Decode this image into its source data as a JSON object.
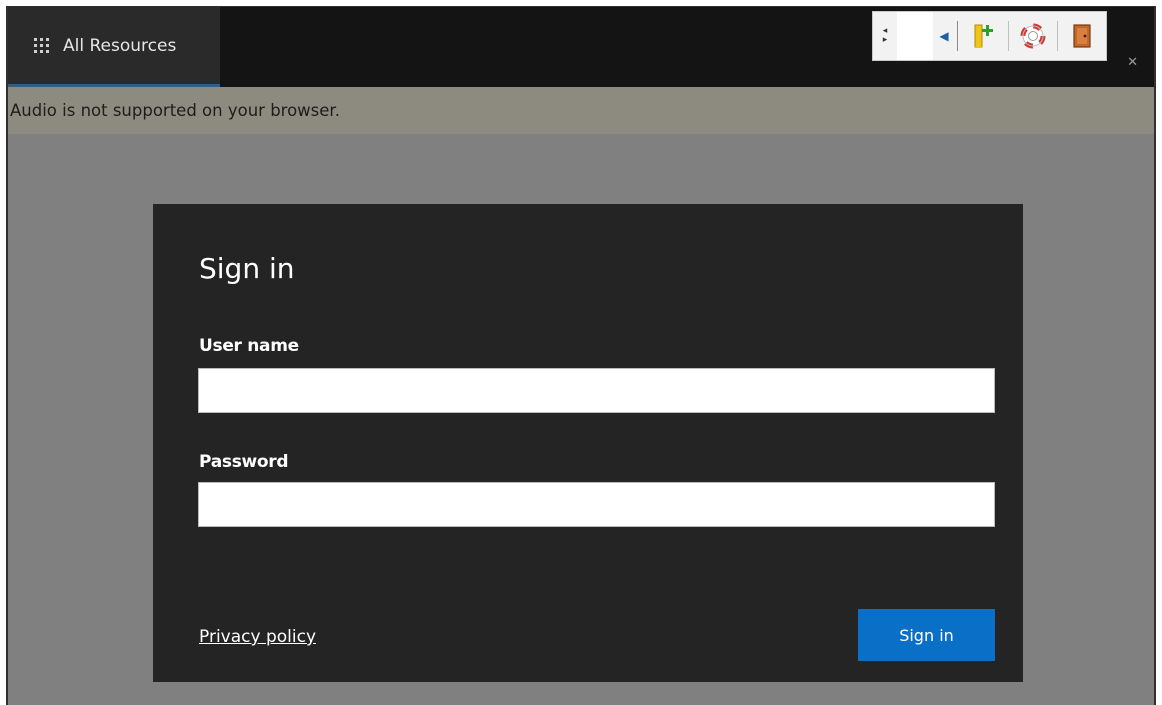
{
  "topbar": {
    "tab_label": "All Resources",
    "tab_icon": "app-launcher-grid-icon",
    "close_glyph": "✕"
  },
  "toolbar": {
    "scroll_icon": "scroll-left-right-icon",
    "collapse_icon": "collapse-left-arrow-icon",
    "buttons": [
      {
        "name": "add-bookmark-icon"
      },
      {
        "name": "help-lifebuoy-icon"
      },
      {
        "name": "exit-door-icon"
      }
    ]
  },
  "notice": {
    "text": "Audio is not supported on your browser."
  },
  "signin": {
    "title": "Sign in",
    "username_label": "User name",
    "username_value": "",
    "password_label": "Password",
    "password_value": "",
    "privacy_link": "Privacy policy",
    "submit_label": "Sign in"
  },
  "colors": {
    "accent": "#0a6fc7",
    "topbar": "#141414",
    "card": "#242424",
    "notice": "#8d8b7f",
    "backdrop": "#808080"
  }
}
